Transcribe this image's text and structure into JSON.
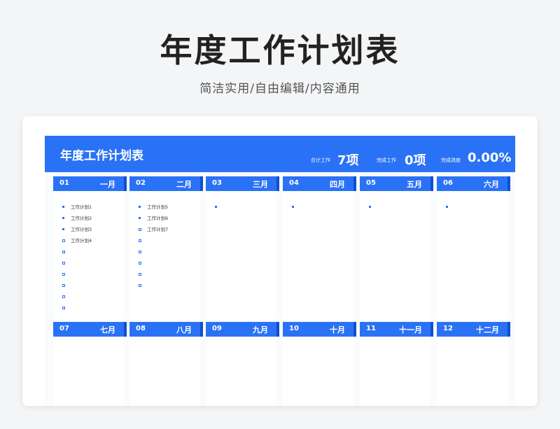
{
  "header": {
    "title": "年度工作计划表",
    "subtitle": "简洁实用/自由编辑/内容通用"
  },
  "banner": {
    "title": "年度工作计划表",
    "stats": [
      {
        "label": "合计工作",
        "value": "7项"
      },
      {
        "label": "完成工作",
        "value": "0项"
      },
      {
        "label": "完成进度",
        "value": "0.00%"
      }
    ]
  },
  "months": [
    {
      "num": "01",
      "name": "一月",
      "tasks": [
        {
          "text": "工作计划1",
          "done": true
        },
        {
          "text": "工作计划2",
          "done": true
        },
        {
          "text": "工作计划3",
          "done": true
        },
        {
          "text": "工作计划4",
          "done": false
        },
        {
          "text": "",
          "done": false
        },
        {
          "text": "",
          "done": false
        },
        {
          "text": "",
          "done": false
        },
        {
          "text": "",
          "done": false
        },
        {
          "text": "",
          "done": false
        },
        {
          "text": "",
          "done": false
        }
      ]
    },
    {
      "num": "02",
      "name": "二月",
      "tasks": [
        {
          "text": "工作计划5",
          "done": true
        },
        {
          "text": "工作计划6",
          "done": true
        },
        {
          "text": "工作计划7",
          "done": false
        },
        {
          "text": "",
          "done": false
        },
        {
          "text": "",
          "done": false
        },
        {
          "text": "",
          "done": false
        },
        {
          "text": "",
          "done": false
        },
        {
          "text": "",
          "done": false
        }
      ]
    },
    {
      "num": "03",
      "name": "三月",
      "tasks": [
        {
          "text": "",
          "done": true
        }
      ]
    },
    {
      "num": "04",
      "name": "四月",
      "tasks": [
        {
          "text": "",
          "done": true
        }
      ]
    },
    {
      "num": "05",
      "name": "五月",
      "tasks": [
        {
          "text": "",
          "done": true
        }
      ]
    },
    {
      "num": "06",
      "name": "六月",
      "tasks": [
        {
          "text": "",
          "done": true
        }
      ]
    },
    {
      "num": "07",
      "name": "七月",
      "tasks": []
    },
    {
      "num": "08",
      "name": "八月",
      "tasks": []
    },
    {
      "num": "09",
      "name": "九月",
      "tasks": []
    },
    {
      "num": "10",
      "name": "十月",
      "tasks": []
    },
    {
      "num": "11",
      "name": "十一月",
      "tasks": []
    },
    {
      "num": "12",
      "name": "十二月",
      "tasks": []
    }
  ],
  "colors": {
    "accent": "#2a72f5",
    "accent_dark": "#0f4fd0",
    "background": "#f4f5f7"
  }
}
